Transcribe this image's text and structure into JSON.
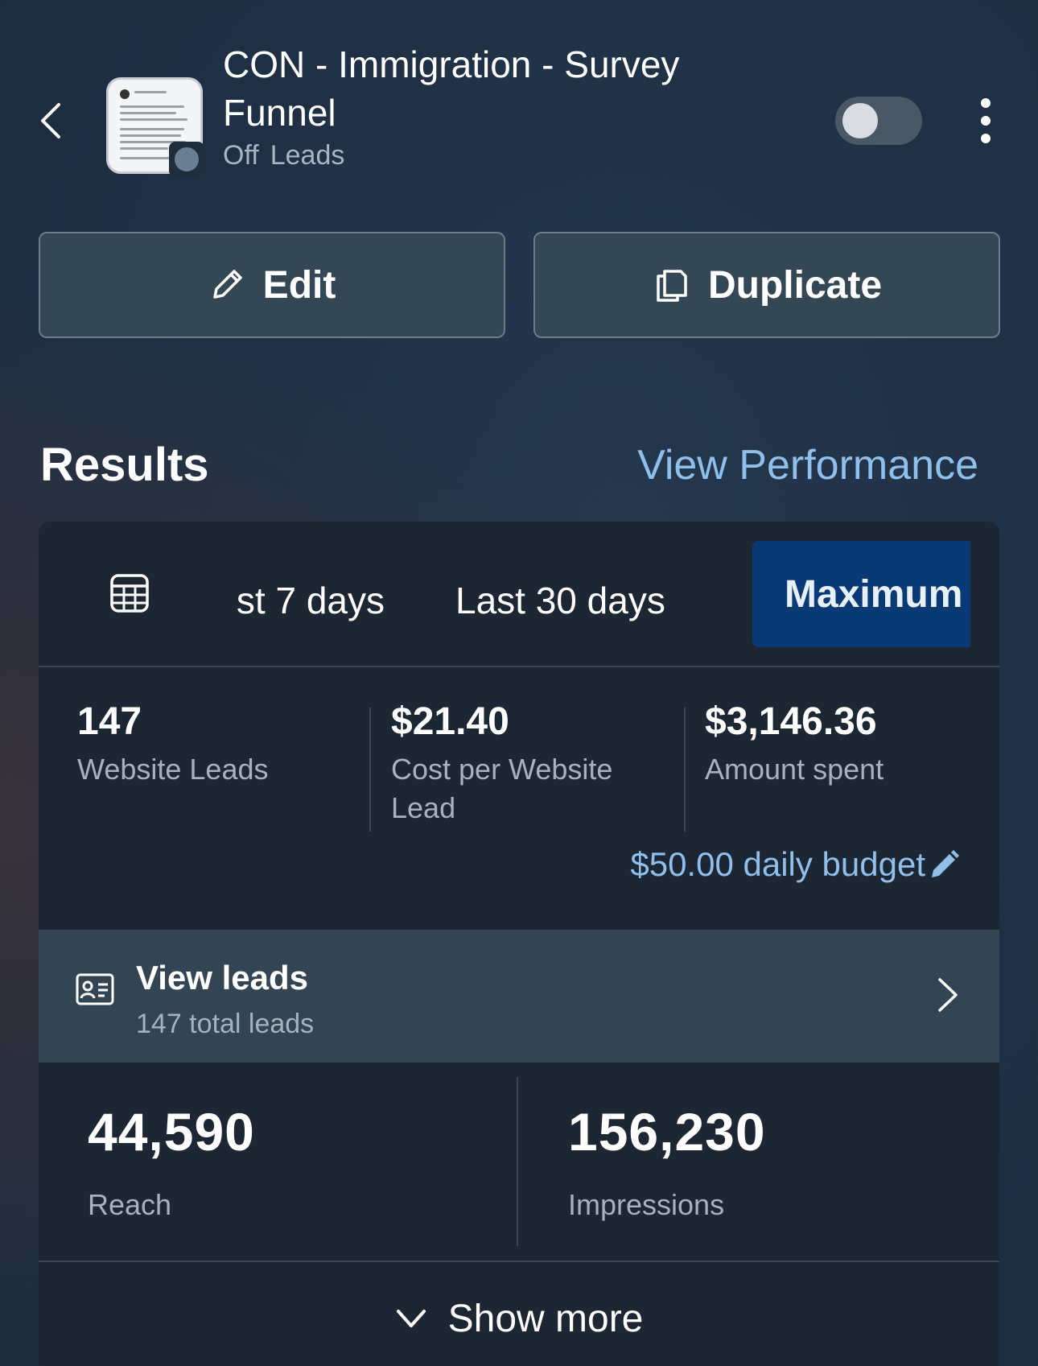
{
  "header": {
    "title": "CON - Immigration - Survey Funnel",
    "status": "Off",
    "objective": "Leads",
    "toggle_on": false
  },
  "actions": {
    "edit_label": "Edit",
    "duplicate_label": "Duplicate"
  },
  "results": {
    "title": "Results",
    "view_performance": "View Performance",
    "tabs": {
      "last_7": "st 7 days",
      "last_30": "Last 30 days",
      "maximum": "Maximum"
    },
    "selected_tab": "Maximum",
    "metrics": [
      {
        "value": "147",
        "label": "Website Leads"
      },
      {
        "value": "$21.40",
        "label": "Cost per Website Lead"
      },
      {
        "value": "$3,146.36",
        "label": "Amount spent"
      }
    ],
    "budget": "$50.00 daily budget",
    "leads": {
      "title": "View leads",
      "subtitle": "147 total leads"
    },
    "reach": {
      "value": "44,590",
      "label": "Reach"
    },
    "impressions": {
      "value": "156,230",
      "label": "Impressions"
    },
    "show_more": "Show more"
  },
  "icons": {
    "back": "chevron-left-icon",
    "edit": "pencil-icon",
    "duplicate": "copy-icon",
    "calendar": "calendar-icon",
    "budget_edit": "pencil-icon",
    "leads": "contact-card-icon",
    "leads_chevron": "chevron-right-icon",
    "show_more": "chevron-down-icon"
  },
  "colors": {
    "accent_link": "#8fbfea",
    "selected_tab_bg": "#0a3a75",
    "card_bg": "#1d2733"
  }
}
